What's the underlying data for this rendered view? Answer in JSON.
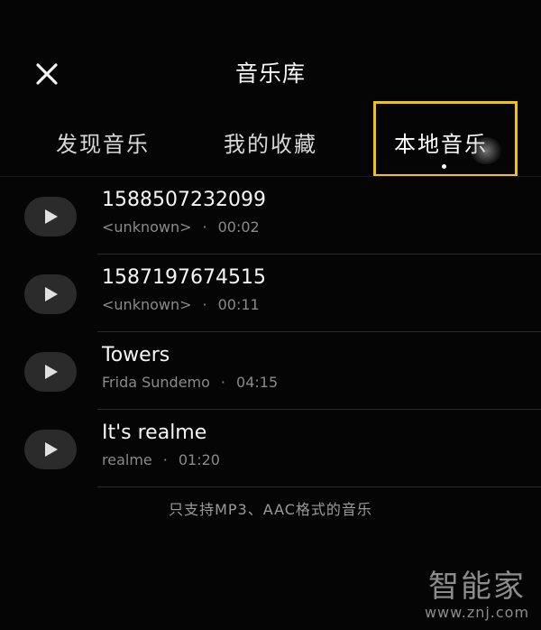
{
  "header": {
    "close_icon": "close-icon",
    "title": "音乐库"
  },
  "tabs": [
    {
      "label": "发现音乐",
      "selected": false
    },
    {
      "label": "我的收藏",
      "selected": false
    },
    {
      "label": "本地音乐",
      "selected": true
    }
  ],
  "highlight_color": "#f3c20f",
  "songs": [
    {
      "title": "1588507232099",
      "artist": "<unknown>",
      "separator": "·",
      "duration": "00:02"
    },
    {
      "title": "1587197674515",
      "artist": "<unknown>",
      "separator": "·",
      "duration": "00:11"
    },
    {
      "title": "Towers",
      "artist": "Frida Sundemo",
      "separator": "·",
      "duration": "04:15"
    },
    {
      "title": "It's realme",
      "artist": "realme",
      "separator": "·",
      "duration": "01:20"
    }
  ],
  "footnote": "只支持MP3、AAC格式的音乐",
  "watermark": {
    "logo_text": "智能家",
    "url": "www.znj.com"
  }
}
